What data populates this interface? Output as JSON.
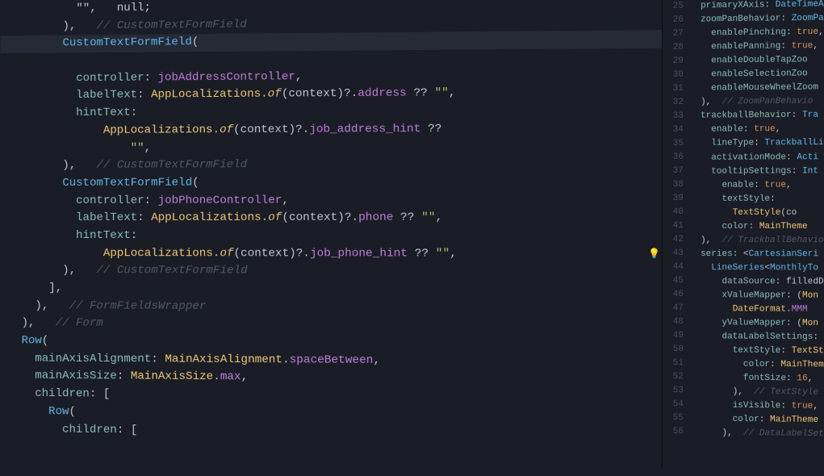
{
  "leftPane": {
    "lines": [
      {
        "indent": 10,
        "tokens": [
          [
            "op",
            "\"\""
          ],
          [
            "op",
            ","
          ],
          [
            "op",
            "   null"
          ],
          [
            "op",
            ";"
          ]
        ]
      },
      {
        "indent": 8,
        "tokens": [
          [
            "op",
            ")"
          ],
          [
            "op",
            ","
          ],
          [
            "cmt",
            "   // CustomTextFormField"
          ]
        ]
      },
      {
        "indent": 8,
        "hl": true,
        "tokens": [
          [
            "cls",
            "CustomTextFormField"
          ],
          [
            "op",
            "("
          ]
        ]
      },
      {
        "indent": 10,
        "tokens": [
          [
            "param",
            "controller"
          ],
          [
            "op",
            ": "
          ],
          [
            "fn",
            "jobAddressController"
          ],
          [
            "op",
            ","
          ]
        ]
      },
      {
        "indent": 10,
        "tokens": [
          [
            "param",
            "labelText"
          ],
          [
            "op",
            ": "
          ],
          [
            "cls2",
            "AppLocalizations"
          ],
          [
            "op",
            "."
          ],
          [
            "fnOf",
            "of"
          ],
          [
            "op",
            "(context)?."
          ],
          [
            "fn",
            "address"
          ],
          [
            "op",
            " ?? "
          ],
          [
            "lit",
            "\"\""
          ],
          [
            "op",
            ","
          ]
        ]
      },
      {
        "indent": 10,
        "tokens": [
          [
            "param",
            "hintText"
          ],
          [
            "op",
            ":"
          ]
        ]
      },
      {
        "indent": 14,
        "tokens": [
          [
            "cls2",
            "AppLocalizations"
          ],
          [
            "op",
            "."
          ],
          [
            "fnOf",
            "of"
          ],
          [
            "op",
            "(context)?."
          ],
          [
            "fn",
            "job_address_hint"
          ],
          [
            "op",
            " ??"
          ]
        ]
      },
      {
        "indent": 18,
        "tokens": [
          [
            "lit",
            "\"\""
          ],
          [
            "op",
            ","
          ]
        ]
      },
      {
        "indent": 8,
        "tokens": [
          [
            "op",
            ")"
          ],
          [
            "op",
            ","
          ],
          [
            "cmt",
            "   // CustomTextFormField"
          ]
        ]
      },
      {
        "indent": 8,
        "tokens": [
          [
            "cls",
            "CustomTextFormField"
          ],
          [
            "op",
            "("
          ]
        ]
      },
      {
        "indent": 10,
        "tokens": [
          [
            "param",
            "controller"
          ],
          [
            "op",
            ": "
          ],
          [
            "fn",
            "jobPhoneController"
          ],
          [
            "op",
            ","
          ]
        ]
      },
      {
        "indent": 10,
        "tokens": [
          [
            "param",
            "labelText"
          ],
          [
            "op",
            ": "
          ],
          [
            "cls2",
            "AppLocalizations"
          ],
          [
            "op",
            "."
          ],
          [
            "fnOf",
            "of"
          ],
          [
            "op",
            "(context)?."
          ],
          [
            "fn",
            "phone"
          ],
          [
            "op",
            " ?? "
          ],
          [
            "lit",
            "\"\""
          ],
          [
            "op",
            ","
          ]
        ]
      },
      {
        "indent": 10,
        "tokens": [
          [
            "param",
            "hintText"
          ],
          [
            "op",
            ":"
          ]
        ]
      },
      {
        "indent": 14,
        "tokens": [
          [
            "cls2",
            "AppLocalizations"
          ],
          [
            "op",
            "."
          ],
          [
            "fnOf",
            "of"
          ],
          [
            "op",
            "(context)?."
          ],
          [
            "fn",
            "job_phone_hint"
          ],
          [
            "op",
            " ?? "
          ],
          [
            "lit",
            "\"\""
          ],
          [
            "op",
            ","
          ]
        ]
      },
      {
        "indent": 8,
        "tokens": [
          [
            "op",
            ")"
          ],
          [
            "op",
            ","
          ],
          [
            "cmt",
            "   // CustomTextFormField"
          ]
        ]
      },
      {
        "indent": 6,
        "tokens": [
          [
            "op",
            "],"
          ]
        ]
      },
      {
        "indent": 4,
        "tokens": [
          [
            "op",
            ")"
          ],
          [
            "op",
            ","
          ],
          [
            "cmt",
            "   // FormFieldsWrapper"
          ]
        ]
      },
      {
        "indent": 2,
        "tokens": [
          [
            "op",
            ")"
          ],
          [
            "op",
            ","
          ],
          [
            "cmt",
            "   // Form"
          ]
        ]
      },
      {
        "indent": 2,
        "tokens": [
          [
            "cls",
            "Row"
          ],
          [
            "op",
            "("
          ]
        ]
      },
      {
        "indent": 4,
        "tokens": [
          [
            "param",
            "mainAxisAlignment"
          ],
          [
            "op",
            ": "
          ],
          [
            "cls2",
            "MainAxisAlignment"
          ],
          [
            "op",
            "."
          ],
          [
            "enum",
            "spaceBetween"
          ],
          [
            "op",
            ","
          ]
        ]
      },
      {
        "indent": 4,
        "tokens": [
          [
            "param",
            "mainAxisSize"
          ],
          [
            "op",
            ": "
          ],
          [
            "cls2",
            "MainAxisSize"
          ],
          [
            "op",
            "."
          ],
          [
            "enum",
            "max"
          ],
          [
            "op",
            ","
          ]
        ]
      },
      {
        "indent": 4,
        "tokens": [
          [
            "param",
            "children"
          ],
          [
            "op",
            ": ["
          ]
        ]
      },
      {
        "indent": 6,
        "tokens": [
          [
            "cls",
            "Row"
          ],
          [
            "op",
            "("
          ]
        ]
      },
      {
        "indent": 8,
        "tokens": [
          [
            "param",
            "children"
          ],
          [
            "op",
            ": ["
          ]
        ]
      }
    ]
  },
  "rightPane": {
    "startLine": 25,
    "bulbAtLine": 43,
    "lines": [
      {
        "indent": 2,
        "tokens": [
          [
            "param",
            "primaryXAxis"
          ],
          [
            "op",
            ": "
          ],
          [
            "cls",
            "DateTimeAxis"
          ]
        ]
      },
      {
        "indent": 2,
        "tokens": [
          [
            "param",
            "zoomPanBehavior"
          ],
          [
            "op",
            ": "
          ],
          [
            "cls",
            "ZoomPa"
          ]
        ]
      },
      {
        "indent": 4,
        "tokens": [
          [
            "param",
            "enablePinching"
          ],
          [
            "op",
            ": "
          ],
          [
            "num",
            "true"
          ],
          [
            "op",
            ","
          ]
        ]
      },
      {
        "indent": 4,
        "tokens": [
          [
            "param",
            "enablePanning"
          ],
          [
            "op",
            ": "
          ],
          [
            "num",
            "true"
          ],
          [
            "op",
            ","
          ]
        ]
      },
      {
        "indent": 4,
        "tokens": [
          [
            "param",
            "enableDoubleTapZoo"
          ]
        ]
      },
      {
        "indent": 4,
        "tokens": [
          [
            "param",
            "enableSelectionZoo"
          ]
        ]
      },
      {
        "indent": 4,
        "tokens": [
          [
            "param",
            "enableMouseWheelZoom"
          ]
        ]
      },
      {
        "indent": 2,
        "tokens": [
          [
            "op",
            "),"
          ],
          [
            "cmt",
            "  // ZoomPanBehavio"
          ]
        ]
      },
      {
        "indent": 2,
        "tokens": [
          [
            "param",
            "trackballBehavior"
          ],
          [
            "op",
            ": "
          ],
          [
            "cls",
            "Tra"
          ]
        ]
      },
      {
        "indent": 4,
        "tokens": [
          [
            "param",
            "enable"
          ],
          [
            "op",
            ": "
          ],
          [
            "num",
            "true"
          ],
          [
            "op",
            ","
          ]
        ]
      },
      {
        "indent": 4,
        "tokens": [
          [
            "param",
            "lineType"
          ],
          [
            "op",
            ": "
          ],
          [
            "cls",
            "TrackballLi"
          ]
        ]
      },
      {
        "indent": 4,
        "tokens": [
          [
            "param",
            "activationMode"
          ],
          [
            "op",
            ": "
          ],
          [
            "cls",
            "Acti"
          ]
        ]
      },
      {
        "indent": 4,
        "tokens": [
          [
            "param",
            "tooltipSettings"
          ],
          [
            "op",
            ": "
          ],
          [
            "cls",
            "Int"
          ]
        ]
      },
      {
        "indent": 6,
        "tokens": [
          [
            "param",
            "enable"
          ],
          [
            "op",
            ": "
          ],
          [
            "num",
            "true"
          ],
          [
            "op",
            ","
          ]
        ]
      },
      {
        "indent": 6,
        "tokens": [
          [
            "param",
            "textStyle"
          ],
          [
            "op",
            ":"
          ]
        ]
      },
      {
        "indent": 8,
        "tokens": [
          [
            "typ",
            "TextStyle"
          ],
          [
            "op",
            "(co"
          ]
        ]
      },
      {
        "indent": 6,
        "tokens": [
          [
            "param",
            "color"
          ],
          [
            "op",
            ": "
          ],
          [
            "cls2",
            "MainTheme"
          ]
        ]
      },
      {
        "indent": 2,
        "tokens": [
          [
            "op",
            "),"
          ],
          [
            "cmt",
            "  // TrackballBehavio"
          ]
        ]
      },
      {
        "indent": 2,
        "tokens": [
          [
            "param",
            "series"
          ],
          [
            "op",
            ": <"
          ],
          [
            "cls",
            "CartesianSeri"
          ]
        ]
      },
      {
        "indent": 4,
        "tokens": [
          [
            "cls",
            "LineSeries"
          ],
          [
            "op",
            "<"
          ],
          [
            "cls",
            "MonthlyTo"
          ]
        ]
      },
      {
        "indent": 6,
        "tokens": [
          [
            "param",
            "dataSource"
          ],
          [
            "op",
            ": "
          ],
          [
            "param2",
            "filledD"
          ]
        ]
      },
      {
        "indent": 6,
        "tokens": [
          [
            "param",
            "xValueMapper"
          ],
          [
            "op",
            ": ("
          ],
          [
            "cls2",
            "Mon"
          ]
        ]
      },
      {
        "indent": 8,
        "tokens": [
          [
            "typ",
            "DateFormat"
          ],
          [
            "op",
            "."
          ],
          [
            "enum",
            "MMM"
          ]
        ]
      },
      {
        "indent": 6,
        "tokens": [
          [
            "param",
            "yValueMapper"
          ],
          [
            "op",
            ": ("
          ],
          [
            "cls2",
            "Mon"
          ]
        ]
      },
      {
        "indent": 6,
        "tokens": [
          [
            "param",
            "dataLabelSettings"
          ],
          [
            "op",
            ":"
          ]
        ]
      },
      {
        "indent": 8,
        "tokens": [
          [
            "param",
            "textStyle"
          ],
          [
            "op",
            ": "
          ],
          [
            "typ",
            "TextSt"
          ]
        ]
      },
      {
        "indent": 10,
        "tokens": [
          [
            "param",
            "color"
          ],
          [
            "op",
            ": "
          ],
          [
            "cls2",
            "MainThem"
          ]
        ]
      },
      {
        "indent": 10,
        "tokens": [
          [
            "param",
            "fontSize"
          ],
          [
            "op",
            ": "
          ],
          [
            "num",
            "16"
          ],
          [
            "op",
            ","
          ]
        ]
      },
      {
        "indent": 8,
        "tokens": [
          [
            "op",
            "),"
          ],
          [
            "cmt",
            "  // TextStyle"
          ]
        ]
      },
      {
        "indent": 8,
        "tokens": [
          [
            "param",
            "isVisible"
          ],
          [
            "op",
            ": "
          ],
          [
            "num",
            "true"
          ],
          [
            "op",
            ","
          ]
        ]
      },
      {
        "indent": 8,
        "tokens": [
          [
            "param",
            "color"
          ],
          [
            "op",
            ": "
          ],
          [
            "cls2",
            "MainTheme"
          ]
        ]
      },
      {
        "indent": 6,
        "tokens": [
          [
            "op",
            "),"
          ],
          [
            "cmt",
            "  // DataLabelSet"
          ]
        ]
      }
    ]
  }
}
